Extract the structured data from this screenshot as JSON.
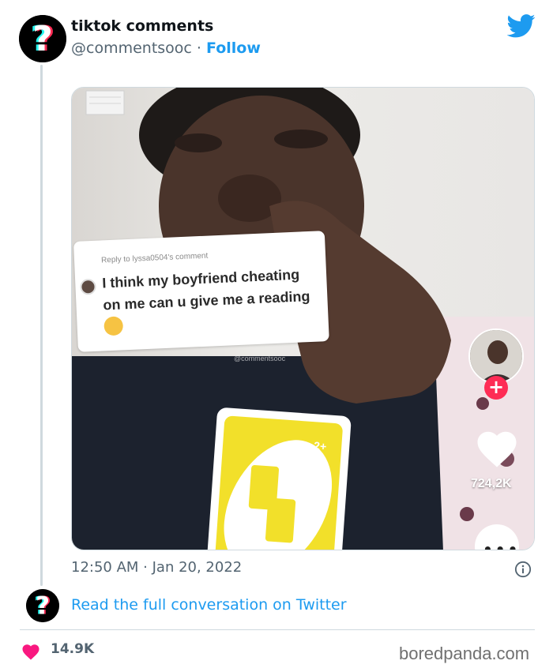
{
  "tweet": {
    "user_name": "tiktok comments",
    "handle": "@commentsooc",
    "separator": "·",
    "follow_label": "Follow",
    "timestamp": "12:50 AM · Jan 20, 2022",
    "read_conversation_label": "Read the full conversation on Twitter",
    "like_count": "14.9K"
  },
  "tiktok": {
    "reply_to": "Reply to lyssa0504's comment",
    "comment_text": "I think my boyfriend cheating on me can u give me a reading",
    "watermark": "@commentsooc",
    "likes": "724,2K",
    "card_text": "2+"
  },
  "footer": {
    "brand": "boredpanda.com"
  },
  "colors": {
    "twitter_blue": "#1d9bf0",
    "like_pink": "#f91880",
    "tiktok_red": "#fe2c55",
    "uno_yellow": "#f2e02a"
  },
  "icons": {
    "avatar": "question-mark-logo",
    "brand": "twitter-bird-icon",
    "info": "info-icon",
    "like": "heart-icon"
  }
}
